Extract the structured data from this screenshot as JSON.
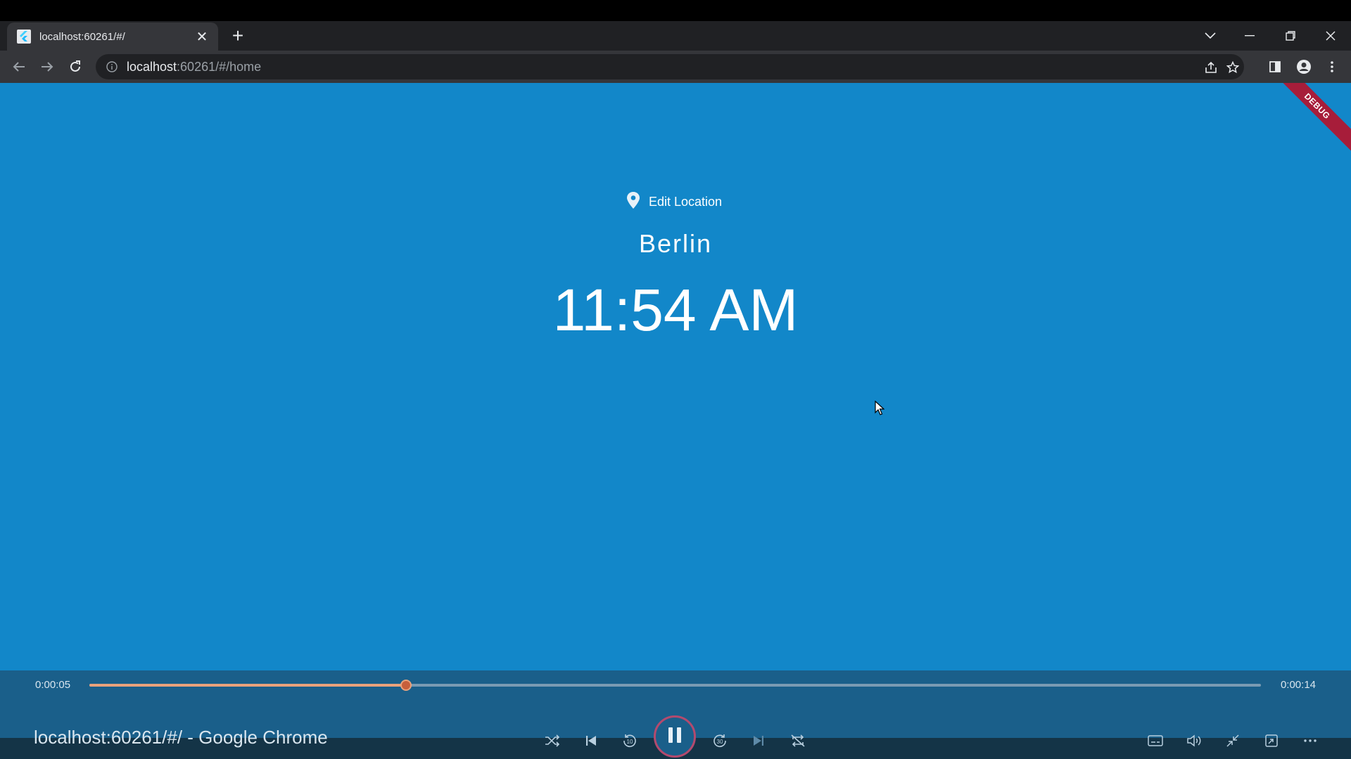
{
  "browser": {
    "tab_title": "localhost:60261/#/",
    "url_host": "localhost",
    "url_rest": ":60261/#/home"
  },
  "app": {
    "edit_location_label": "Edit Location",
    "city": "Berlin",
    "time": "11:54 AM",
    "debug_banner": "DEBUG",
    "background_color": "#1287c9"
  },
  "player": {
    "current_time": "0:00:05",
    "total_time": "0:00:14",
    "progress_fraction": 0.27,
    "window_title": "localhost:60261/#/ - Google Chrome",
    "accent_color": "#e9a27c"
  },
  "icons": {
    "tab_favicon": "flutter-icon",
    "location": "location-pin-icon",
    "shuffle": "shuffle-icon",
    "previous": "skip-previous-icon",
    "rewind": "rewind-10-icon",
    "pause": "pause-icon",
    "forward": "forward-30-icon",
    "next": "skip-next-icon",
    "repeat": "repeat-off-icon"
  }
}
